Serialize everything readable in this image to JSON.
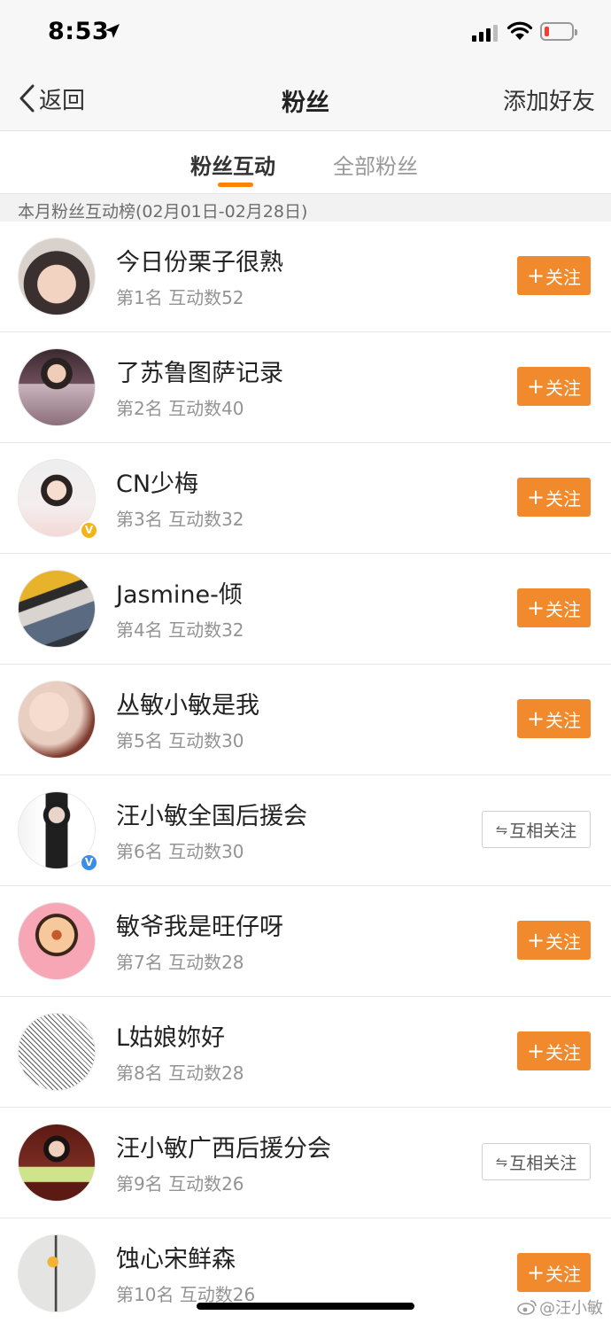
{
  "status_bar": {
    "time": "8:53",
    "signal_bars_filled": 3,
    "battery_level_percent": 10
  },
  "nav": {
    "back_label": "返回",
    "title": "粉丝",
    "add_friend_label": "添加好友"
  },
  "tabs": [
    {
      "label": "粉丝互动",
      "active": true
    },
    {
      "label": "全部粉丝",
      "active": false
    }
  ],
  "section_label": "本月粉丝互动榜(02月01日-02月28日)",
  "fans": [
    {
      "name": "今日份栗子很熟",
      "meta": "第1名 互动数52",
      "button": "关注",
      "button_type": "follow",
      "verified": ""
    },
    {
      "name": "了苏鲁图萨记录",
      "meta": "第2名 互动数40",
      "button": "关注",
      "button_type": "follow",
      "verified": ""
    },
    {
      "name": "CN少梅",
      "meta": "第3名 互动数32",
      "button": "关注",
      "button_type": "follow",
      "verified": "gold"
    },
    {
      "name": "Jasmine-倾",
      "meta": "第4名 互动数32",
      "button": "关注",
      "button_type": "follow",
      "verified": ""
    },
    {
      "name": "丛敏小敏是我",
      "meta": "第5名 互动数30",
      "button": "关注",
      "button_type": "follow",
      "verified": ""
    },
    {
      "name": "汪小敏全国后援会",
      "meta": "第6名 互动数30",
      "button": "互相关注",
      "button_type": "mutual",
      "verified": "blue"
    },
    {
      "name": "敏爷我是旺仔呀",
      "meta": "第7名 互动数28",
      "button": "关注",
      "button_type": "follow",
      "verified": ""
    },
    {
      "name": "L姑娘妳好",
      "meta": "第8名 互动数28",
      "button": "关注",
      "button_type": "follow",
      "verified": ""
    },
    {
      "name": "汪小敏广西后援分会",
      "meta": "第9名 互动数26",
      "button": "互相关注",
      "button_type": "mutual",
      "verified": ""
    },
    {
      "name": "蚀心宋鲜森",
      "meta": "第10名 互动数26",
      "button": "关注",
      "button_type": "follow",
      "verified": ""
    }
  ],
  "watermark": "@汪小敏",
  "colors": {
    "accent": "#ff8200",
    "follow_button": "#f08a2c",
    "verified_gold": "#f6b318",
    "verified_blue": "#3a8ee6"
  },
  "icons": {
    "back": "chevron-left-icon",
    "location": "location-arrow-icon",
    "wifi": "wifi-icon",
    "battery": "battery-icon",
    "verified": "verified-v-icon",
    "follow_plus": "plus-icon",
    "mutual": "swap-arrows-icon",
    "weibo": "weibo-icon"
  }
}
